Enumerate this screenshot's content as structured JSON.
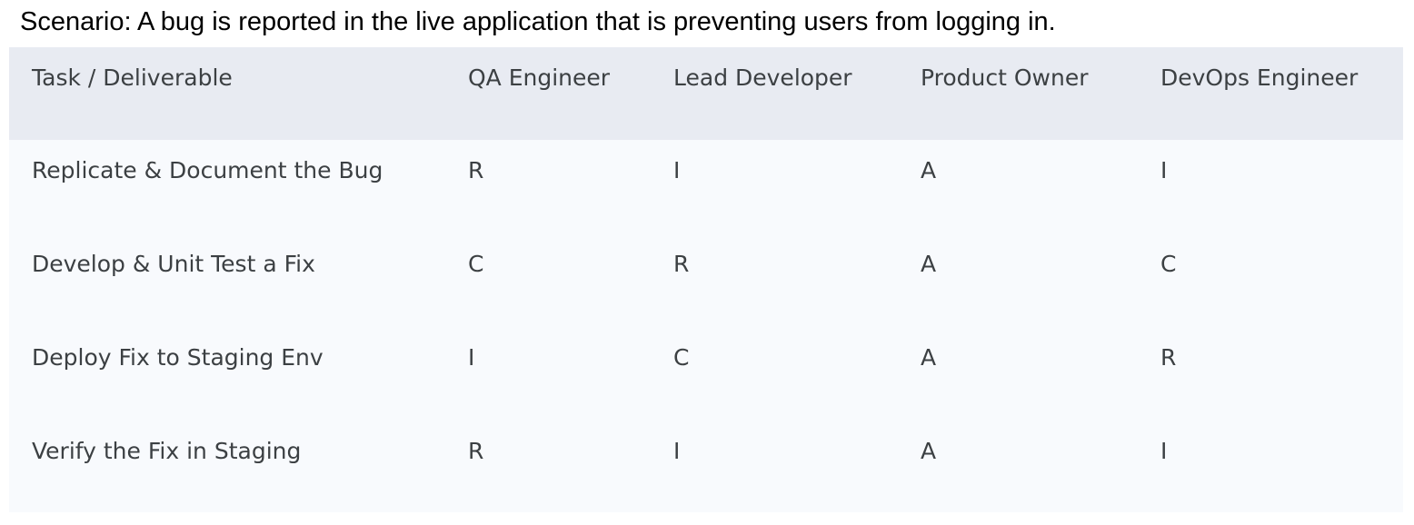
{
  "scenario": "Scenario: A bug is reported in the live application that is preventing users from logging in.",
  "table": {
    "headers": [
      "Task / Deliverable",
      "QA Engineer",
      "Lead Developer",
      "Product Owner",
      "DevOps Engineer"
    ],
    "rows": [
      [
        "Replicate & Document the Bug",
        "R",
        "I",
        "A",
        "I"
      ],
      [
        "Develop & Unit Test a Fix",
        "C",
        "R",
        "A",
        "C"
      ],
      [
        "Deploy Fix to Staging Env",
        "I",
        "C",
        "A",
        "R"
      ],
      [
        "Verify the Fix in Staging",
        "R",
        "I",
        "A",
        "I"
      ]
    ]
  }
}
